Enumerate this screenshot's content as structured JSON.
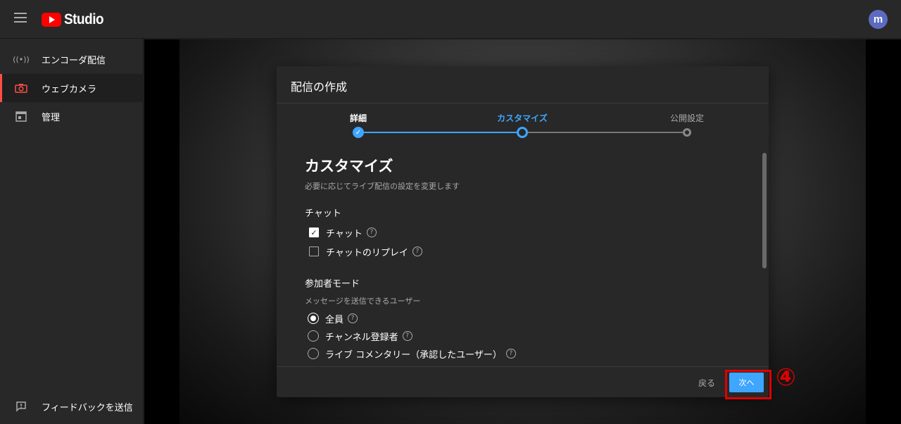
{
  "topbar": {
    "logo_text": "Studio",
    "avatar_letter": "m"
  },
  "sidebar": {
    "items": [
      {
        "label": "エンコーダ配信",
        "icon": "broadcast-icon"
      },
      {
        "label": "ウェブカメラ",
        "icon": "camera-icon"
      },
      {
        "label": "管理",
        "icon": "calendar-icon"
      }
    ],
    "feedback_label": "フィードバックを送信"
  },
  "modal": {
    "title": "配信の作成",
    "steps": [
      {
        "label": "詳細",
        "state": "done"
      },
      {
        "label": "カスタマイズ",
        "state": "current"
      },
      {
        "label": "公開設定",
        "state": "todo"
      }
    ],
    "heading": "カスタマイズ",
    "description": "必要に応じてライブ配信の設定を変更します",
    "chat": {
      "title": "チャット",
      "options": [
        {
          "label": "チャット",
          "checked": true
        },
        {
          "label": "チャットのリプレイ",
          "checked": false
        }
      ]
    },
    "participant": {
      "title": "参加者モード",
      "subtitle": "メッセージを送信できるユーザー",
      "options": [
        {
          "label": "全員",
          "checked": true
        },
        {
          "label": "チャンネル登録者",
          "checked": false
        },
        {
          "label": "ライブ コメンタリー（承認したユーザー）",
          "checked": false
        }
      ]
    },
    "footer": {
      "back_label": "戻る",
      "next_label": "次へ"
    }
  },
  "annotation": {
    "label": "④"
  },
  "colors": {
    "accent": "#3ea6ff",
    "brand": "#ff0000",
    "highlight": "#e00000"
  }
}
